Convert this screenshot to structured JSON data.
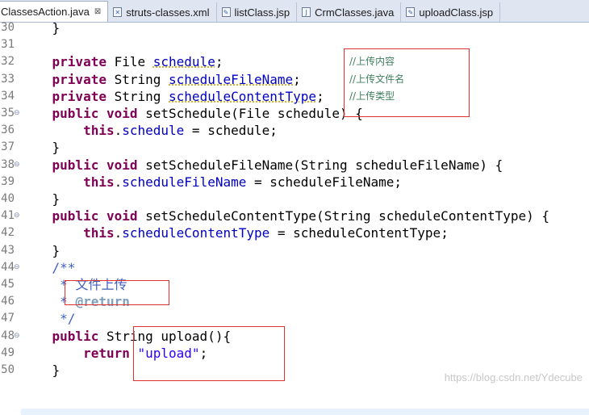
{
  "tabs": [
    {
      "label": "ClassesAction.java",
      "active": true,
      "close": "⊠"
    },
    {
      "label": "struts-classes.xml"
    },
    {
      "label": "listClass.jsp"
    },
    {
      "label": "CrmClasses.java"
    },
    {
      "label": "uploadClass.jsp"
    }
  ],
  "lines": [
    {
      "num": "30",
      "t": [
        [
          "    }",
          ""
        ]
      ]
    },
    {
      "num": "31",
      "t": []
    },
    {
      "num": "32",
      "t": [
        [
          "    ",
          ""
        ],
        [
          "private",
          "kw"
        ],
        [
          " File ",
          ""
        ],
        [
          "schedule",
          "fld"
        ],
        [
          ";",
          ""
        ]
      ]
    },
    {
      "num": "33",
      "t": [
        [
          "    ",
          ""
        ],
        [
          "private",
          "kw"
        ],
        [
          " String ",
          ""
        ],
        [
          "scheduleFileName",
          "fld"
        ],
        [
          ";",
          ""
        ]
      ]
    },
    {
      "num": "34",
      "t": [
        [
          "    ",
          ""
        ],
        [
          "private",
          "kw"
        ],
        [
          " String ",
          ""
        ],
        [
          "scheduleContentType",
          "fld"
        ],
        [
          ";",
          ""
        ]
      ]
    },
    {
      "num": "35",
      "fold": "⊖",
      "t": [
        [
          "    ",
          ""
        ],
        [
          "public",
          "kw"
        ],
        [
          " ",
          ""
        ],
        [
          "void",
          "kw"
        ],
        [
          " setSchedule(File schedule) {",
          ""
        ]
      ]
    },
    {
      "num": "36",
      "t": [
        [
          "        ",
          ""
        ],
        [
          "this",
          "kw"
        ],
        [
          ".",
          ""
        ],
        [
          "schedule",
          "fld"
        ],
        [
          " = schedule;",
          ""
        ]
      ]
    },
    {
      "num": "37",
      "t": [
        [
          "    }",
          ""
        ]
      ]
    },
    {
      "num": "38",
      "fold": "⊖",
      "t": [
        [
          "    ",
          ""
        ],
        [
          "public",
          "kw"
        ],
        [
          " ",
          ""
        ],
        [
          "void",
          "kw"
        ],
        [
          " setScheduleFileName(String scheduleFileName) {",
          ""
        ]
      ]
    },
    {
      "num": "39",
      "t": [
        [
          "        ",
          ""
        ],
        [
          "this",
          "kw"
        ],
        [
          ".",
          ""
        ],
        [
          "scheduleFileName",
          "fld"
        ],
        [
          " = scheduleFileName;",
          ""
        ]
      ]
    },
    {
      "num": "40",
      "t": [
        [
          "    }",
          ""
        ]
      ]
    },
    {
      "num": "41",
      "fold": "⊖",
      "t": [
        [
          "    ",
          ""
        ],
        [
          "public",
          "kw"
        ],
        [
          " ",
          ""
        ],
        [
          "void",
          "kw"
        ],
        [
          " setScheduleContentType(String scheduleContentType) {",
          ""
        ]
      ]
    },
    {
      "num": "42",
      "t": [
        [
          "        ",
          ""
        ],
        [
          "this",
          "kw"
        ],
        [
          ".",
          ""
        ],
        [
          "scheduleContentType",
          "fld"
        ],
        [
          " = scheduleContentType;",
          ""
        ]
      ]
    },
    {
      "num": "43",
      "t": [
        [
          "    }",
          ""
        ]
      ]
    },
    {
      "num": "44",
      "fold": "⊖",
      "t": [
        [
          "    ",
          ""
        ],
        [
          "/**",
          "jd"
        ]
      ]
    },
    {
      "num": "45",
      "t": [
        [
          "     ",
          ""
        ],
        [
          "* ",
          "jd"
        ],
        [
          "文件上传",
          "jd"
        ]
      ]
    },
    {
      "num": "46",
      "t": [
        [
          "     ",
          ""
        ],
        [
          "* ",
          "jd"
        ],
        [
          "@return",
          "jdtag"
        ]
      ]
    },
    {
      "num": "47",
      "t": [
        [
          "     ",
          ""
        ],
        [
          "*/",
          "jd"
        ]
      ]
    },
    {
      "num": "48",
      "fold": "⊖",
      "t": [
        [
          "    ",
          ""
        ],
        [
          "public",
          "kw"
        ],
        [
          " String upload(){",
          ""
        ]
      ]
    },
    {
      "num": "49",
      "t": [
        [
          "        ",
          ""
        ],
        [
          "return",
          "kw"
        ],
        [
          " ",
          ""
        ],
        [
          "\"upload\"",
          "str"
        ],
        [
          ";",
          ""
        ]
      ]
    },
    {
      "num": "50",
      "t": [
        [
          "    }",
          ""
        ]
      ]
    }
  ],
  "comments": [
    {
      "line": 2,
      "text": "//上传内容"
    },
    {
      "line": 3,
      "text": "//上传文件名"
    },
    {
      "line": 4,
      "text": "//上传类型"
    }
  ],
  "watermark": "https://blog.csdn.net/Ydecube",
  "colors": {
    "keyword": "#7f0055",
    "field": "#0000c0",
    "comment": "#3f7f5f",
    "javadoc": "#3f5fbf",
    "string": "#2a00ff",
    "highlight_box": "#e03030"
  }
}
